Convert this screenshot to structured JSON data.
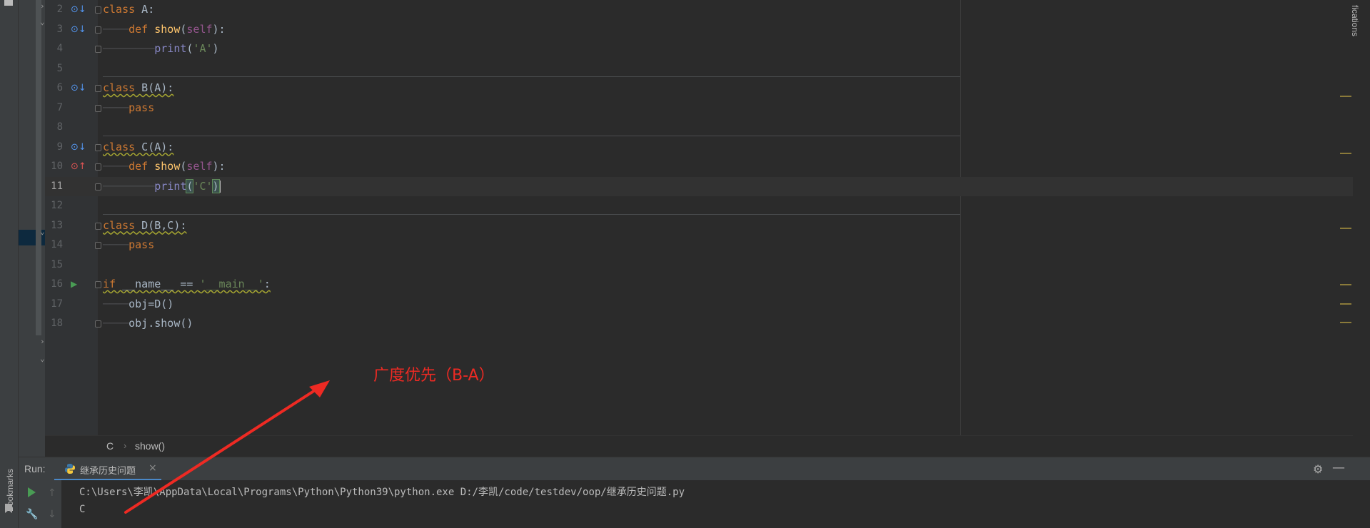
{
  "editor": {
    "lines": [
      {
        "n": "2",
        "tokens": [
          [
            "k",
            "class"
          ],
          [
            "",
            "  A:"
          ]
        ]
      },
      {
        "n": "3"
      },
      {
        "n": "4"
      },
      {
        "n": "5"
      },
      {
        "n": "6"
      },
      {
        "n": "7"
      },
      {
        "n": "8"
      },
      {
        "n": "9"
      },
      {
        "n": "10"
      },
      {
        "n": "11"
      },
      {
        "n": "12"
      },
      {
        "n": "13"
      },
      {
        "n": "14"
      },
      {
        "n": "15"
      },
      {
        "n": "16"
      },
      {
        "n": "17"
      },
      {
        "n": "18"
      }
    ],
    "code": {
      "l2_kw": "class",
      "l2_rest": " A:",
      "l3_def": "def",
      "l3_fn": "show",
      "l3_open": "(",
      "l3_self": "self",
      "l3_close": "):",
      "l4_print": "print",
      "l4_open": "(",
      "l4_str": "'A'",
      "l4_close": ")",
      "l6_kw": "class",
      "l6_rest": " B(A):",
      "l7_pass": "pass",
      "l9_kw": "class",
      "l9_rest": " C(A):",
      "l10_def": "def",
      "l10_fn": "show",
      "l10_open": "(",
      "l10_self": "self",
      "l10_close": "):",
      "l11_print": "print",
      "l11_open": "(",
      "l11_str": "'C'",
      "l11_close": ")",
      "l13_kw": "class",
      "l13_rest": " D(B,C):",
      "l14_pass": "pass",
      "l16_if": "if",
      "l16_name": " __name__ == ",
      "l16_str": "'__main__'",
      "l16_colon": ":",
      "l17_code": "obj=D()",
      "l18_code": "obj.show()"
    },
    "active_line": "11"
  },
  "breadcrumb": {
    "class": "C",
    "method": "show()"
  },
  "right_panel": {
    "notifications_label": "fications"
  },
  "left_panel": {
    "bookmarks_label": "Bookmarks"
  },
  "run": {
    "label": "Run:",
    "tab_name": "继承历史问题",
    "command": "C:\\Users\\李凯\\AppData\\Local\\Programs\\Python\\Python39\\python.exe D:/李凯/code/testdev/oop/继承历史问题.py",
    "output": "C"
  },
  "annotation": {
    "text": "广度优先（B-A）",
    "color": "#ee2a23"
  },
  "colors": {
    "keyword": "#cc7832",
    "function": "#ffc66d",
    "string": "#6a8759",
    "self": "#94558d",
    "builtin": "#8888c6",
    "background": "#2b2b2b"
  }
}
